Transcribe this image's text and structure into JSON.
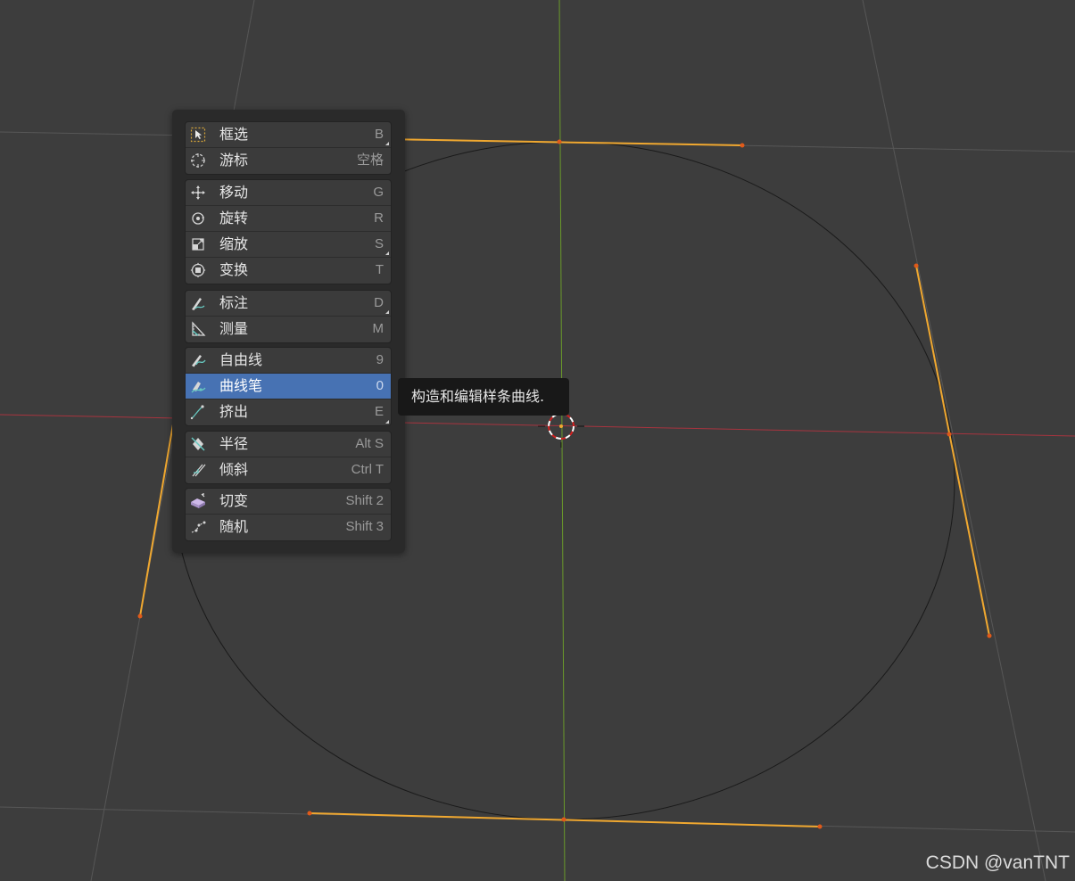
{
  "menu": {
    "groups": [
      {
        "items": [
          {
            "label": "框选",
            "shortcut": "B",
            "icon": "select-box-icon",
            "corner": true
          },
          {
            "label": "游标",
            "shortcut": "空格",
            "icon": "cursor-icon",
            "corner": false
          }
        ]
      },
      {
        "items": [
          {
            "label": "移动",
            "shortcut": "G",
            "icon": "move-icon",
            "corner": false
          },
          {
            "label": "旋转",
            "shortcut": "R",
            "icon": "rotate-icon",
            "corner": false
          },
          {
            "label": "缩放",
            "shortcut": "S",
            "icon": "scale-icon",
            "corner": true
          },
          {
            "label": "变换",
            "shortcut": "T",
            "icon": "transform-icon",
            "corner": false
          }
        ]
      },
      {
        "items": [
          {
            "label": "标注",
            "shortcut": "D",
            "icon": "annotate-icon",
            "corner": true
          },
          {
            "label": "测量",
            "shortcut": "M",
            "icon": "measure-icon",
            "corner": false
          }
        ]
      },
      {
        "items": [
          {
            "label": "自由线",
            "shortcut": "9",
            "icon": "draw-icon",
            "corner": false
          },
          {
            "label": "曲线笔",
            "shortcut": "0",
            "icon": "curve-pen-icon",
            "corner": false,
            "active": true
          },
          {
            "label": "挤出",
            "shortcut": "E",
            "icon": "extrude-icon",
            "corner": true
          }
        ]
      },
      {
        "items": [
          {
            "label": "半径",
            "shortcut": "Alt S",
            "icon": "radius-icon",
            "corner": false
          },
          {
            "label": "倾斜",
            "shortcut": "Ctrl T",
            "icon": "tilt-icon",
            "corner": false
          }
        ]
      },
      {
        "items": [
          {
            "label": "切变",
            "shortcut": "Shift 2",
            "icon": "shear-icon",
            "corner": false
          },
          {
            "label": "随机",
            "shortcut": "Shift 3",
            "icon": "randomize-icon",
            "corner": false
          }
        ]
      }
    ]
  },
  "tooltip": {
    "text": "构造和编辑样条曲线."
  },
  "watermark": {
    "text": "CSDN @vanTNT"
  },
  "colors": {
    "background": "#3d3d3d",
    "handle": "#f0a830",
    "handle_point": "#e05a1a",
    "x_axis": "#a8343f",
    "y_axis": "#6a9a2a",
    "grid": "#575757",
    "curve": "#1a1a1a",
    "active_item": "#4772b3"
  }
}
